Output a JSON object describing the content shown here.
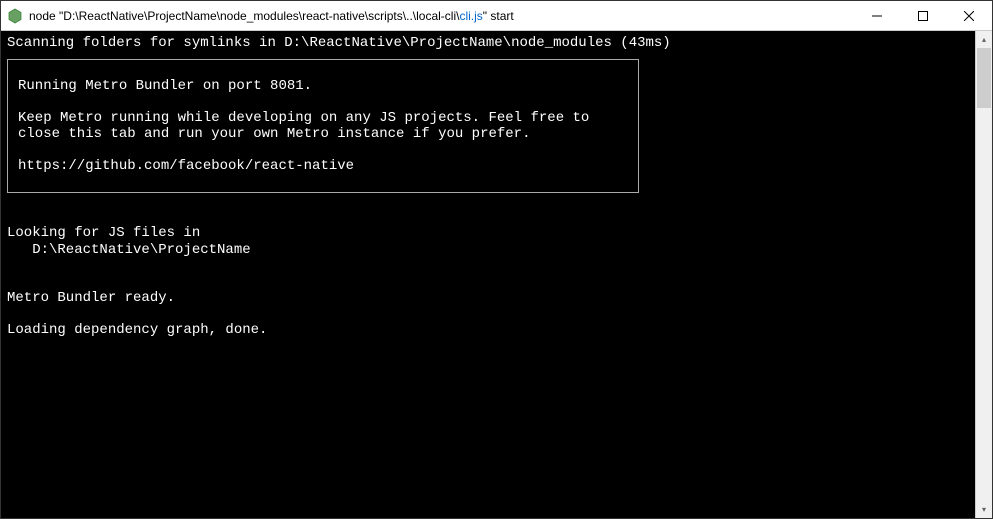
{
  "titlebar": {
    "title_prefix": "node  \"D:\\ReactNative\\ProjectName\\node_modules\\react-native\\scripts\\..\\local-cli\\",
    "title_cli": "cli.js",
    "title_suffix": "\" start"
  },
  "terminal": {
    "line_scan": "Scanning folders for symlinks in D:\\ReactNative\\ProjectName\\node_modules (43ms)",
    "box_line1": "Running Metro Bundler on port 8081.",
    "box_line2": "Keep Metro running while developing on any JS projects. Feel free to",
    "box_line3": "close this tab and run your own Metro instance if you prefer.",
    "box_link": "https://github.com/facebook/react-native",
    "line_looking": "Looking for JS files in",
    "line_path": "   D:\\ReactNative\\ProjectName",
    "line_ready": "Metro Bundler ready.",
    "line_loading": "Loading dependency graph, done."
  }
}
